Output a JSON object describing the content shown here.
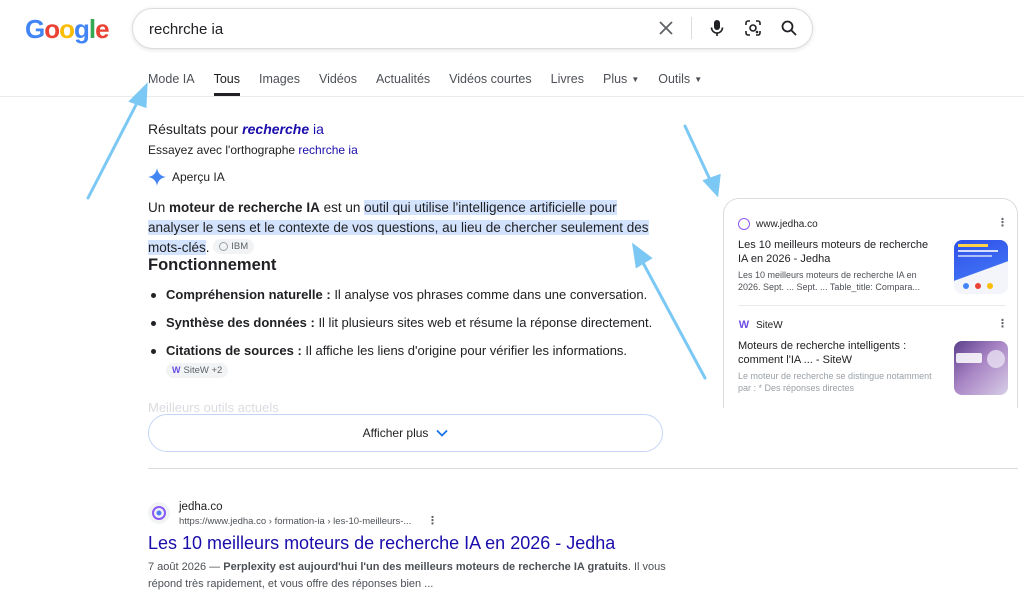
{
  "logo": {
    "letters": [
      "G",
      "o",
      "o",
      "g",
      "l",
      "e"
    ],
    "colors": [
      "#4285f4",
      "#ea4335",
      "#fbbc05",
      "#4285f4",
      "#34a853",
      "#ea4335"
    ]
  },
  "search": {
    "value": "rechrche ia"
  },
  "tabs": [
    {
      "label": "Mode IA",
      "active": false
    },
    {
      "label": "Tous",
      "active": true
    },
    {
      "label": "Images",
      "active": false
    },
    {
      "label": "Vidéos",
      "active": false
    },
    {
      "label": "Actualités",
      "active": false
    },
    {
      "label": "Vidéos courtes",
      "active": false
    },
    {
      "label": "Livres",
      "active": false
    },
    {
      "label": "Plus",
      "active": false,
      "caret": true
    },
    {
      "label": "Outils",
      "active": false,
      "caret": true
    }
  ],
  "spelling": {
    "results_prefix": "Résultats pour",
    "corrected_bold": "recherche",
    "corrected_rest": "ia",
    "try_prefix": "Essayez avec l'orthographe",
    "try_link": "rechrche ia"
  },
  "ai_overview": {
    "label": "Aperçu IA",
    "intro_1": "Un ",
    "intro_bold": "moteur de recherche IA",
    "intro_2": " est un ",
    "highlight": "outil qui utilise l'intelligence artificielle pour analyser le sens et le contexte de vos questions, au lieu de chercher seulement des mots-clés",
    "after": ".",
    "chip_ibm": "IBM",
    "heading": "Fonctionnement",
    "bullets": [
      {
        "bold": "Compréhension naturelle :",
        "text": " Il analyse vos phrases comme dans une conversation."
      },
      {
        "bold": "Synthèse des données :",
        "text": " Il lit plusieurs sites web et résume la réponse directement."
      },
      {
        "bold": "Citations de sources :",
        "text": " Il affiche les liens d'origine pour vérifier les informations."
      }
    ],
    "chip_sitew": "SiteW +2",
    "faded": "Meilleurs outils actuels",
    "show_more": "Afficher plus"
  },
  "sources": [
    {
      "site": "www.jedha.co",
      "title": "Les 10 meilleurs moteurs de recherche IA en 2026 - Jedha",
      "desc": "Les 10 meilleurs moteurs de recherche IA en 2026. Sept. ... Sept. ... Table_title: Compara..."
    },
    {
      "site": "SiteW",
      "title": "Moteurs de recherche intelligents : comment l'IA ... - SiteW",
      "desc": "Le moteur de recherche se distingue notamment par : * Des réponses directes"
    }
  ],
  "result": {
    "site": "jedha.co",
    "url": "https://www.jedha.co › formation-ia › les-10-meilleurs-...",
    "title": "Les 10 meilleurs moteurs de recherche IA en 2026 - Jedha",
    "date": "7 août 2026 — ",
    "snippet_bold": "Perplexity est aujourd'hui l'un des meilleurs moteurs de recherche IA gratuits",
    "snippet_rest": ". Il vous répond très rapidement, et vous offre des réponses bien ..."
  },
  "colors": {
    "link": "#1a0dab",
    "highlight": "#d3e3fd",
    "arrow": "#7cc8f5"
  }
}
